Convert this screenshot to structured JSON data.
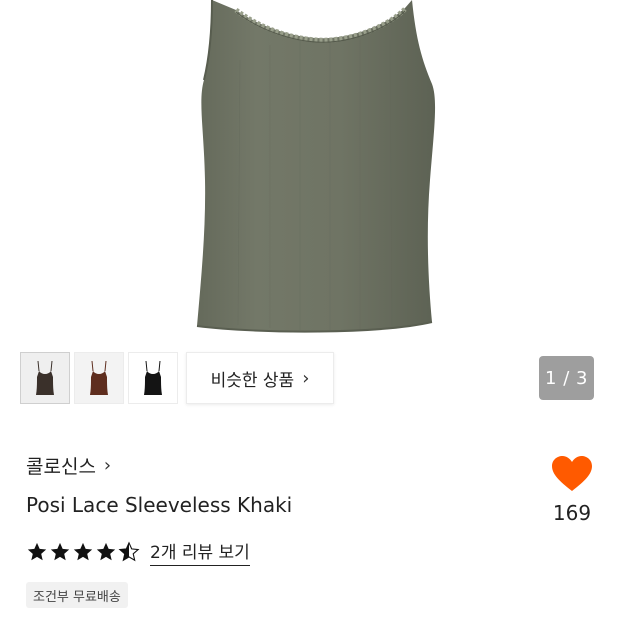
{
  "gallery": {
    "similar_label": "비슷한 상품",
    "similar_chevron": "›",
    "page_indicator": "1 / 3",
    "thumbnails": [
      {
        "name": "dark-brown-top",
        "color": "#3a302a"
      },
      {
        "name": "brown-top",
        "color": "#5e2d1e"
      },
      {
        "name": "black-top",
        "color": "#141414"
      }
    ]
  },
  "product": {
    "brand": "콜로신스",
    "brand_chevron": "›",
    "name": "Posi Lace Sleeveless Khaki",
    "rating": 4.5,
    "review_link": "2개 리뷰 보기",
    "shipping_badge": "조건부 무료배송",
    "like_count": "169"
  },
  "colors": {
    "heart": "#ff5a00",
    "product_khaki": "#6f7464",
    "star": "#111111"
  },
  "icons": {
    "like": "heart-icon",
    "star": "star-icon"
  }
}
